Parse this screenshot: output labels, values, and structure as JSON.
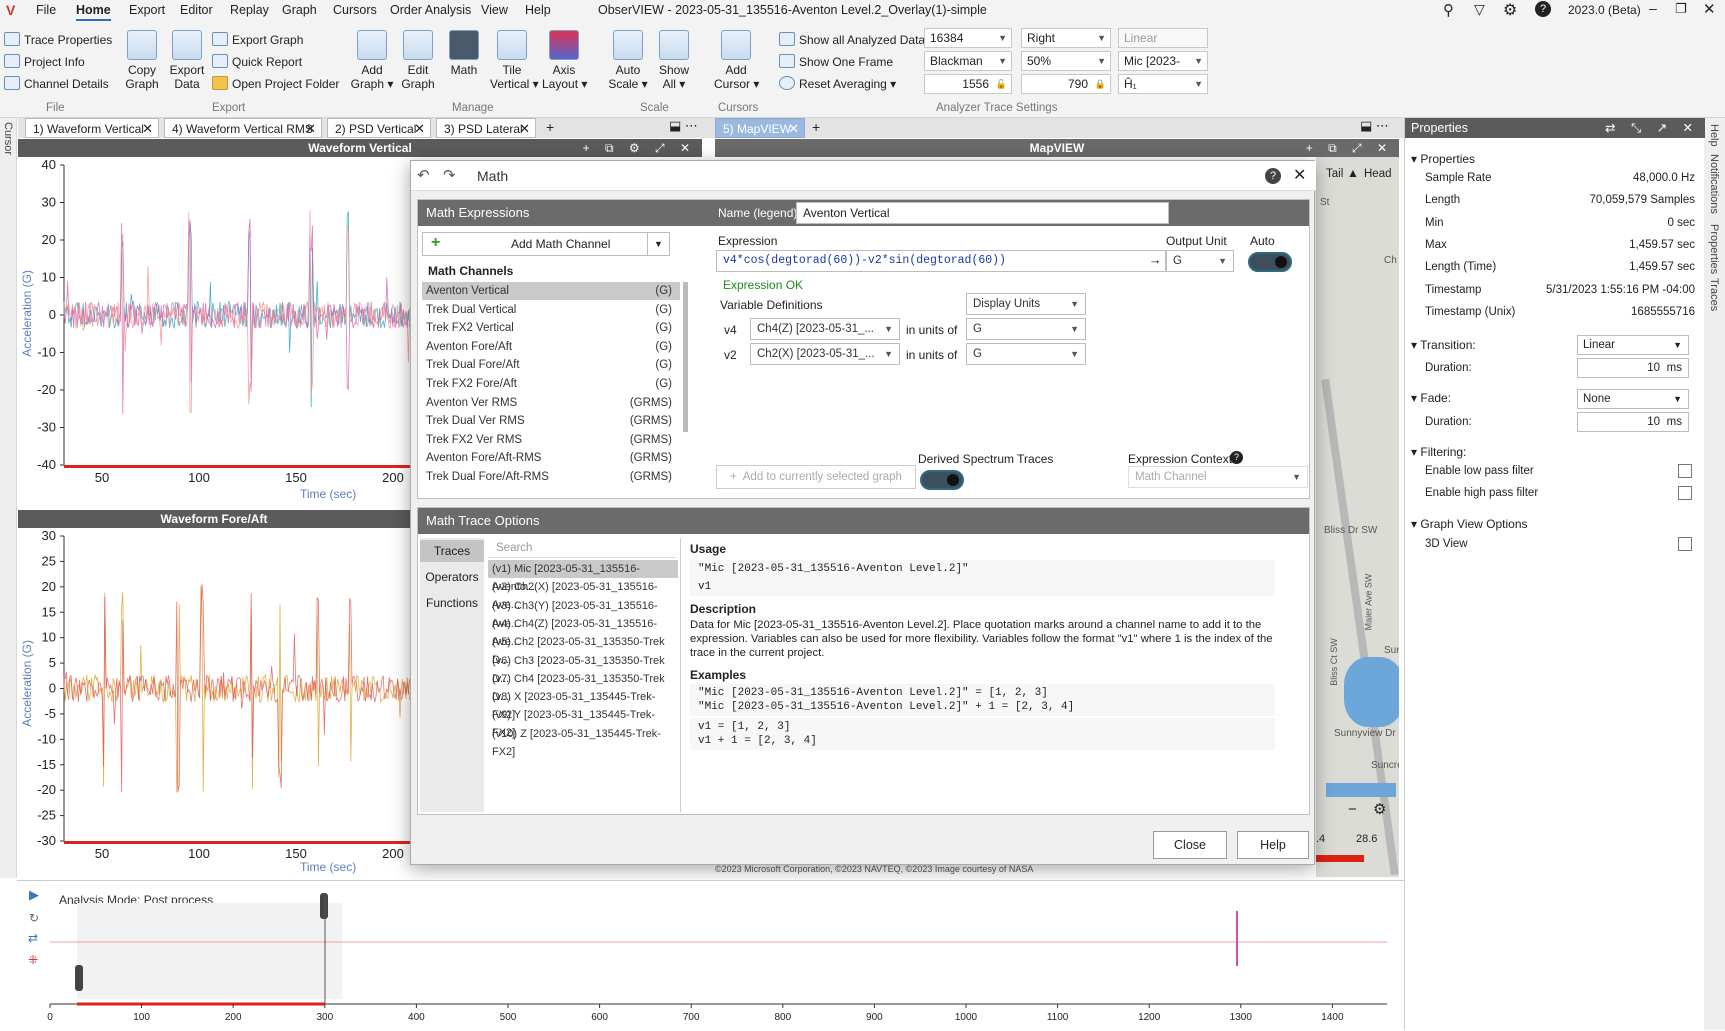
{
  "window": {
    "title": "ObserVIEW - 2023-05-31_135516-Aventon Level.2_Overlay(1)-simple",
    "version": "2023.0 (Beta)"
  },
  "menu": [
    "File",
    "Home",
    "Export",
    "Editor",
    "Replay",
    "Graph",
    "Cursors",
    "Order Analysis",
    "View",
    "Help"
  ],
  "ribbon": {
    "file": {
      "trace_properties": "Trace Properties",
      "project_info": "Project Info",
      "channel_details": "Channel Details",
      "label": "File"
    },
    "export": {
      "copy_graph": "Copy\nGraph",
      "export_data": "Export\nData",
      "export_graph": "Export Graph",
      "quick_report": "Quick Report",
      "open_project_folder": "Open Project Folder",
      "label": "Export"
    },
    "manage": {
      "add_graph": "Add\nGraph ▾",
      "edit_graph": "Edit\nGraph",
      "math": "Math",
      "tile_vertical": "Tile\nVertical ▾",
      "axis_layout": "Axis\nLayout ▾",
      "label": "Manage"
    },
    "scale": {
      "auto_scale": "Auto\nScale ▾",
      "show_all": "Show\nAll ▾",
      "label": "Scale"
    },
    "cursors": {
      "add_cursor": "Add\nCursor ▾",
      "label": "Cursors"
    },
    "analyzer": {
      "show_all_analyzed": "Show all Analyzed Data",
      "show_one_frame": "Show One Frame",
      "reset_averaging": "Reset Averaging",
      "label": "Analyzer Trace Settings",
      "fft_size": "16384",
      "window": "Blackman",
      "frames": "1556",
      "side": "Right",
      "overlap": "50%",
      "frame_value": "790",
      "scale": "Linear",
      "source": "Mic [2023-",
      "axis": "Ĥ₁"
    }
  },
  "left_rail": "Cursor",
  "right_rail": [
    "Help",
    "Notifications",
    "Properties",
    "Traces"
  ],
  "tabs_left": [
    {
      "label": "1) Waveform Vertical"
    },
    {
      "label": "4) Waveform Vertical RMS"
    },
    {
      "label": "2) PSD Vertical"
    },
    {
      "label": "3) PSD Lateral"
    }
  ],
  "tabs_right": [
    {
      "label": "5) MapVIEW"
    }
  ],
  "graph1": {
    "title": "Waveform Vertical",
    "ylabel": "Acceleration (G)",
    "xlabel": "Time (sec)",
    "yticks": [
      "40",
      "30",
      "20",
      "10",
      "0",
      "-10",
      "-20",
      "-30",
      "-40"
    ],
    "xticks": [
      "50",
      "100",
      "150",
      "200"
    ]
  },
  "graph2": {
    "title": "Waveform Fore/Aft",
    "ylabel": "Acceleration (G)",
    "xlabel": "Time (sec)",
    "yticks": [
      "30",
      "25",
      "20",
      "15",
      "10",
      "5",
      "0",
      "-5",
      "-10",
      "-15",
      "-20",
      "-25",
      "-30"
    ],
    "xticks": [
      "50",
      "100",
      "150",
      "200"
    ]
  },
  "map": {
    "title": "MapVIEW",
    "tail": "Tail",
    "head": "Head",
    "streets": [
      "St",
      "Ch",
      "Bliss Dr SW",
      "Bliss Ct SW",
      "Maier Ave SW",
      "Sunnyview Dr",
      "Suncrest",
      "Sun"
    ],
    "copyright": "©2023 Microsoft Corporation, ©2023 NAVTEQ, ©2023 Image courtesy of NASA",
    "scale_left": ".4",
    "scale_right": "28.6"
  },
  "math": {
    "title": "Math",
    "expressions_header": "Math Expressions",
    "add_channel": "Add Math Channel",
    "channels_header": "Math Channels",
    "channels": [
      {
        "name": "Aventon Vertical",
        "unit": "(G)"
      },
      {
        "name": "Trek Dual Vertical",
        "unit": "(G)"
      },
      {
        "name": "Trek FX2 Vertical",
        "unit": "(G)"
      },
      {
        "name": "Aventon Fore/Aft",
        "unit": "(G)"
      },
      {
        "name": "Trek Dual Fore/Aft",
        "unit": "(G)"
      },
      {
        "name": "Trek FX2 Fore/Aft",
        "unit": "(G)"
      },
      {
        "name": "Aventon Ver RMS",
        "unit": "(GRMS)"
      },
      {
        "name": "Trek Dual Ver RMS",
        "unit": "(GRMS)"
      },
      {
        "name": "Trek FX2 Ver RMS",
        "unit": "(GRMS)"
      },
      {
        "name": "Aventon Fore/Aft-RMS",
        "unit": "(GRMS)"
      },
      {
        "name": "Trek Dual Fore/Aft-RMS",
        "unit": "(GRMS)"
      }
    ],
    "name_label": "Name (legend)",
    "name_value": "Aventon Vertical",
    "expression_label": "Expression",
    "expression": "v4*cos(degtorad(60))-v2*sin(degtorad(60))",
    "output_unit_label": "Output Unit",
    "output_unit": "G",
    "auto_label": "Auto",
    "status": "Expression OK",
    "var_defs_label": "Variable Definitions",
    "display_units": "Display Units",
    "vars": [
      {
        "name": "v4",
        "channel": "Ch4(Z) [2023-05-31_...",
        "in_units": "in units of",
        "unit": "G"
      },
      {
        "name": "v2",
        "channel": "Ch2(X) [2023-05-31_...",
        "in_units": "in units of",
        "unit": "G"
      }
    ],
    "add_to_graph": "Add to currently selected graph",
    "derived_label": "Derived Spectrum Traces",
    "context_label": "Expression Context",
    "context_value": "Math Channel",
    "options_header": "Math Trace Options",
    "option_tabs": [
      "Traces",
      "Operators",
      "Functions"
    ],
    "search_placeholder": "Search",
    "traces": [
      "(v1) Mic [2023-05-31_135516-Avento...",
      "(v2) Ch2(X) [2023-05-31_135516-Ave...",
      "(v3) Ch3(Y) [2023-05-31_135516-Ave...",
      "(v4) Ch4(Z) [2023-05-31_135516-Ave...",
      "(v5) Ch2 [2023-05-31_135350-Trek D...",
      "(v6) Ch3 [2023-05-31_135350-Trek D...",
      "(v7) Ch4 [2023-05-31_135350-Trek D...",
      "(v8) X [2023-05-31_135445-Trek-FX2]",
      "(v9) Y [2023-05-31_135445-Trek-FX2]",
      "(v10) Z [2023-05-31_135445-Trek-FX2]"
    ],
    "usage_label": "Usage",
    "usage_1": "\"Mic [2023-05-31_135516-Aventon Level.2]\"",
    "usage_2": "v1",
    "description_label": "Description",
    "description": "Data for Mic [2023-05-31_135516-Aventon Level.2]. Place quotation marks around a channel name to add it to the expression. Variables can also be used for more flexibility. Variables follow the format \"v1\" where 1 is the index of the trace in the current project.",
    "examples_label": "Examples",
    "example_1": "\"Mic [2023-05-31_135516-Aventon Level.2]\" = [1, 2, 3]\n\"Mic [2023-05-31_135516-Aventon Level.2]\" + 1 = [2, 3, 4]",
    "example_2": "v1 = [1, 2, 3]\nv1 + 1 = [2, 3, 4]",
    "close": "Close",
    "help": "Help"
  },
  "properties": {
    "title": "Properties",
    "group": "Properties",
    "rows": [
      {
        "k": "Sample Rate",
        "v": "48,000.0 Hz"
      },
      {
        "k": "Length",
        "v": "70,059,579 Samples"
      },
      {
        "k": "Min",
        "v": "0 sec"
      },
      {
        "k": "Max",
        "v": "1,459.57 sec"
      },
      {
        "k": "Length (Time)",
        "v": "1,459.57 sec"
      },
      {
        "k": "Timestamp",
        "v": "5/31/2023 1:55:16 PM -04:00"
      },
      {
        "k": "Timestamp (Unix)",
        "v": "1685555716"
      }
    ],
    "transition": "Transition:",
    "transition_value": "Linear",
    "duration": "Duration:",
    "duration_value": "10",
    "ms": "ms",
    "fade": "Fade:",
    "fade_value": "None",
    "fade_duration_value": "10",
    "filtering": "Filtering:",
    "low_pass": "Enable low pass filter",
    "high_pass": "Enable high pass filter",
    "graph_view": "Graph View Options",
    "view3d": "3D View"
  },
  "timeline": {
    "mode": "Analysis Mode: Post process",
    "ticks": [
      "0",
      "100",
      "200",
      "300",
      "400",
      "500",
      "600",
      "700",
      "800",
      "900",
      "1000",
      "1100",
      "1200",
      "1300",
      "1400"
    ]
  }
}
